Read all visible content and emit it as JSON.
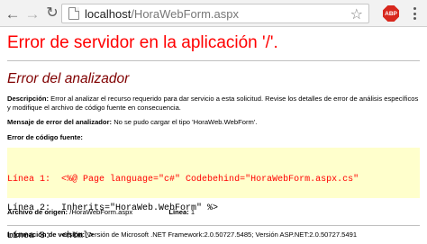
{
  "browser": {
    "url_host": "localhost",
    "url_path": "/HoraWebForm.aspx",
    "abp_label": "ABP"
  },
  "page": {
    "title": "Error de servidor en la aplicación '/'.",
    "subtitle": "Error del analizador",
    "description_label": "Descripción:",
    "description_text": "Error al analizar el recurso requerido para dar servicio a esta solicitud. Revise los detalles de error de análisis específicos y modifique el archivo de código fuente en consecuencia.",
    "parser_msg_label": "Mensaje de error del analizador:",
    "parser_msg_text": "No se pudo cargar el tipo 'HoraWeb.WebForm'.",
    "source_error_label": "Error de código fuente:",
    "code_lines": [
      {
        "label": "Línea 1:",
        "code": "<%@ Page language=\"c#\" Codebehind=\"HoraWebForm.aspx.cs\""
      },
      {
        "label": "Línea 2:",
        "code": "Inherits=\"HoraWeb.WebForm\" %>"
      },
      {
        "label": "Línea 3:",
        "code": "<html>"
      }
    ],
    "source_file_label": "Archivo de origen:",
    "source_file_value": "/HoraWebForm.aspx",
    "line_label": "Línea:",
    "line_value": "1",
    "version_label": "Información de versión:",
    "version_text": "Versión de Microsoft .NET Framework:2.0.50727.5485; Versión ASP.NET:2.0.50727.5491"
  },
  "colors": {
    "title": "#ff0000",
    "subtitle": "#800000",
    "code_background": "#ffffcc",
    "code_error_line": "#ff0000"
  }
}
